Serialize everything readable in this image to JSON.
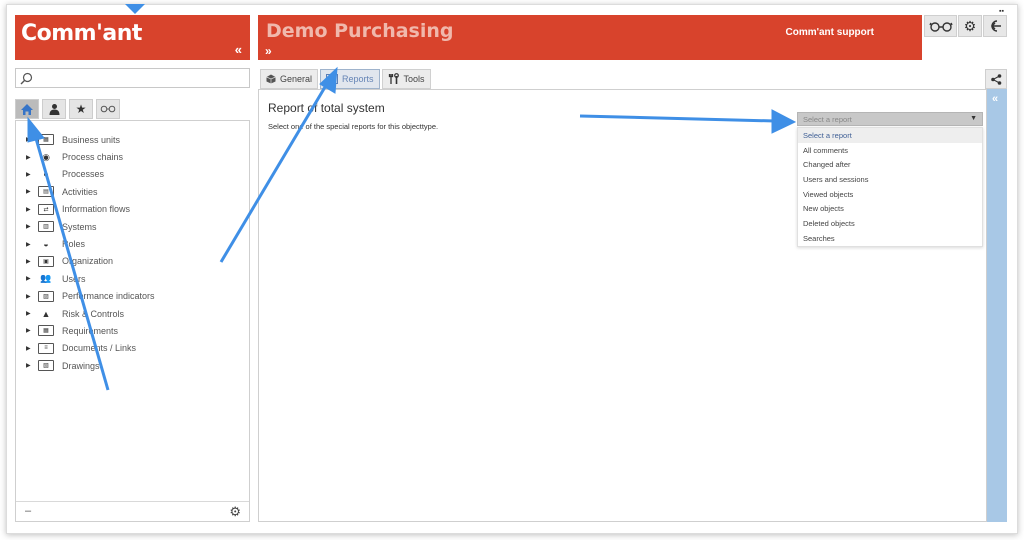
{
  "header": {
    "logo_text": "Comm'ant",
    "collapse_glyph": "«",
    "app_title": "Demo Purchasing",
    "expand_glyph": "»",
    "support_label": "Comm'ant support",
    "icons": [
      "glasses-icon",
      "gear-icon",
      "logout-icon"
    ],
    "corner_mark": "▪▪"
  },
  "search": {
    "placeholder": "",
    "value": ""
  },
  "nav_tabs": [
    {
      "icon": "home-icon",
      "active": true
    },
    {
      "icon": "user-icon",
      "active": false
    },
    {
      "icon": "star-icon",
      "active": false
    },
    {
      "icon": "glasses-icon",
      "active": false
    }
  ],
  "tree": {
    "items": [
      {
        "label": "Business units",
        "icon": "building-icon"
      },
      {
        "label": "Process chains",
        "icon": "process-chain-icon"
      },
      {
        "label": "Processes",
        "icon": "process-icon"
      },
      {
        "label": "Activities",
        "icon": "activity-icon"
      },
      {
        "label": "Information flows",
        "icon": "info-flow-icon"
      },
      {
        "label": "Systems",
        "icon": "system-icon"
      },
      {
        "label": "Roles",
        "icon": "role-icon"
      },
      {
        "label": "Organization",
        "icon": "organization-icon"
      },
      {
        "label": "Users",
        "icon": "users-icon"
      },
      {
        "label": "Performance indicators",
        "icon": "kpi-icon"
      },
      {
        "label": "Risk & Controls",
        "icon": "warning-icon"
      },
      {
        "label": "Requirements",
        "icon": "requirement-icon"
      },
      {
        "label": "Documents / Links",
        "icon": "document-icon"
      },
      {
        "label": "Drawings",
        "icon": "drawing-icon"
      }
    ],
    "footer_minus": "–",
    "footer_gear": "⚙"
  },
  "content_tabs": [
    {
      "label": "General",
      "icon": "cube-icon",
      "active": false
    },
    {
      "label": "Reports",
      "icon": "report-icon",
      "active": true
    },
    {
      "label": "Tools",
      "icon": "tools-icon",
      "active": false
    }
  ],
  "content": {
    "title": "Report of total system",
    "subtitle": "Select one of the special reports for this objecttype.",
    "select": {
      "value": "Select a report",
      "options": [
        "Select a report",
        "All comments",
        "Changed after",
        "Users and sessions",
        "Viewed objects",
        "New objects",
        "Deleted objects",
        "Searches"
      ]
    }
  },
  "right_strip": {
    "glyph": "«"
  },
  "colors": {
    "brand_red": "#d8432c",
    "annotation_blue": "#3f8fe6",
    "right_strip": "#a8c8e6"
  }
}
